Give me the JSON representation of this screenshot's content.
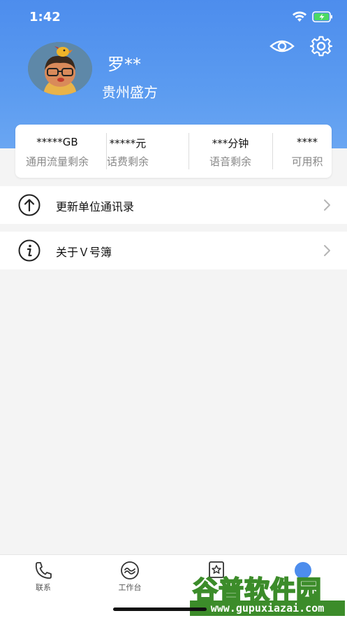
{
  "status_bar": {
    "time": "1:42",
    "icons": [
      "wifi-icon",
      "battery-charging-icon"
    ]
  },
  "profile": {
    "name": "罗**",
    "company": "贵州盛方",
    "avatar_icon": "avatar-cartoon-icon"
  },
  "header_actions": {
    "icons": [
      "eye-icon",
      "gear-icon"
    ]
  },
  "stats": [
    {
      "value": "*****GB",
      "label": "通用流量剩余"
    },
    {
      "value": "*****元",
      "label": "话费剩余"
    },
    {
      "value": "***分钟",
      "label": "语音剩余"
    },
    {
      "value": "****",
      "label": "可用积"
    }
  ],
  "menu": [
    {
      "label": "更新单位通讯录",
      "icon": "upload-arrow-icon"
    },
    {
      "label": "关于Ｖ号簿",
      "icon": "info-icon"
    }
  ],
  "tabbar": [
    {
      "label": "联系",
      "icon": "phone-icon"
    },
    {
      "label": "工作台",
      "icon": "workbench-icon"
    },
    {
      "label": "",
      "icon": "star-icon"
    },
    {
      "label": "",
      "icon": "profile-icon"
    }
  ],
  "watermark": {
    "title": "谷普软件园",
    "url": "www.gupuxiazai.com"
  },
  "colors": {
    "header_blue": "#4d8ded",
    "watermark_green": "#3c8c2a"
  }
}
